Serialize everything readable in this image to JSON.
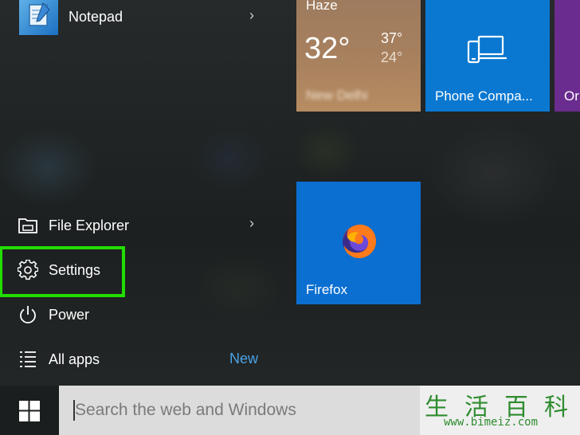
{
  "start_menu": {
    "recent_app": {
      "label": "Notepad",
      "icon": "notepad-icon"
    },
    "bottom_items": [
      {
        "label": "File Explorer",
        "icon": "file-explorer-icon"
      },
      {
        "label": "Settings",
        "icon": "gear-icon"
      },
      {
        "label": "Power",
        "icon": "power-icon"
      },
      {
        "label": "All apps",
        "icon": "list-icon",
        "badge": "New"
      }
    ],
    "highlight_color": "#22dd00"
  },
  "tiles": {
    "weather": {
      "condition": "Haze",
      "temp": "32°",
      "high": "37°",
      "low": "24°",
      "location": "New Delhi"
    },
    "phone": {
      "label": "Phone Compa...",
      "color": "#0078d7"
    },
    "partial": {
      "label": "Or",
      "color": "#5c2d91"
    },
    "firefox": {
      "label": "Firefox",
      "color": "#0a6fd1"
    }
  },
  "taskbar": {
    "start_icon": "windows-logo-icon",
    "search_placeholder": "Search the web and Windows"
  },
  "watermark": {
    "chars": "生活百科",
    "url": "www.bimeiz.com"
  }
}
